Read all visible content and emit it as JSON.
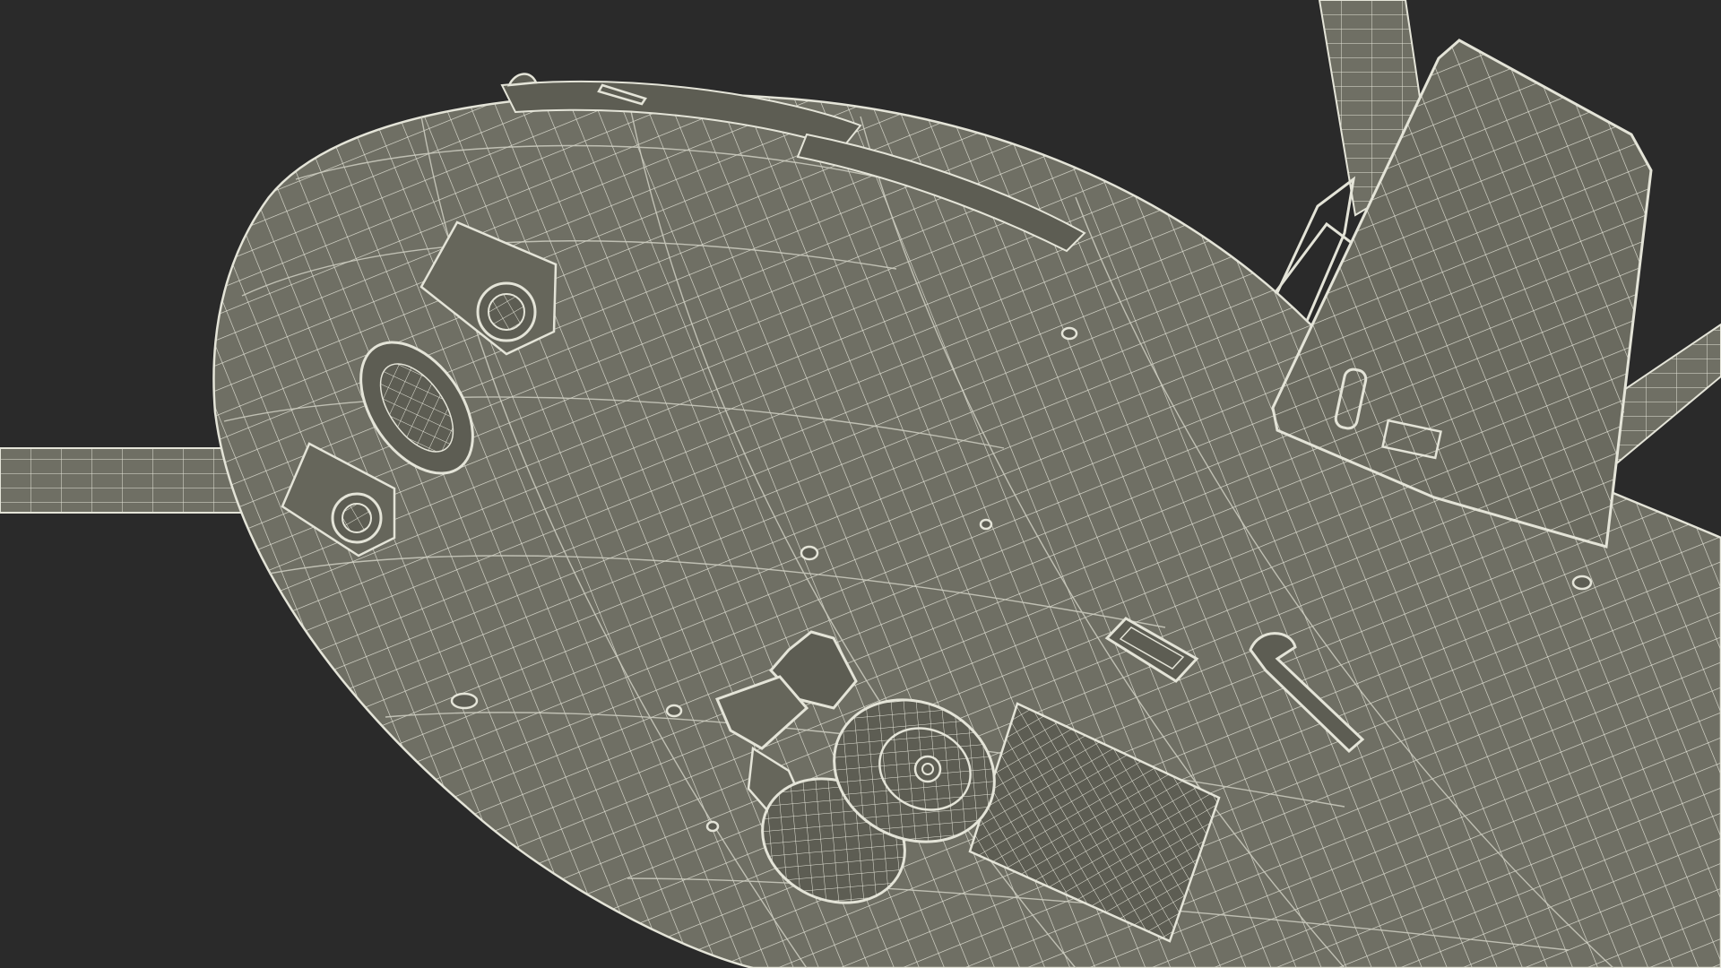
{
  "scene": {
    "subject": "wireframe-aircraft-nose",
    "colors": {
      "background": "#2a2a2a",
      "fill": "#6f6f64",
      "fill_dark": "#5d5d53",
      "wire": "#e4e4d8",
      "wire_faint": "#cfcfc2"
    }
  }
}
